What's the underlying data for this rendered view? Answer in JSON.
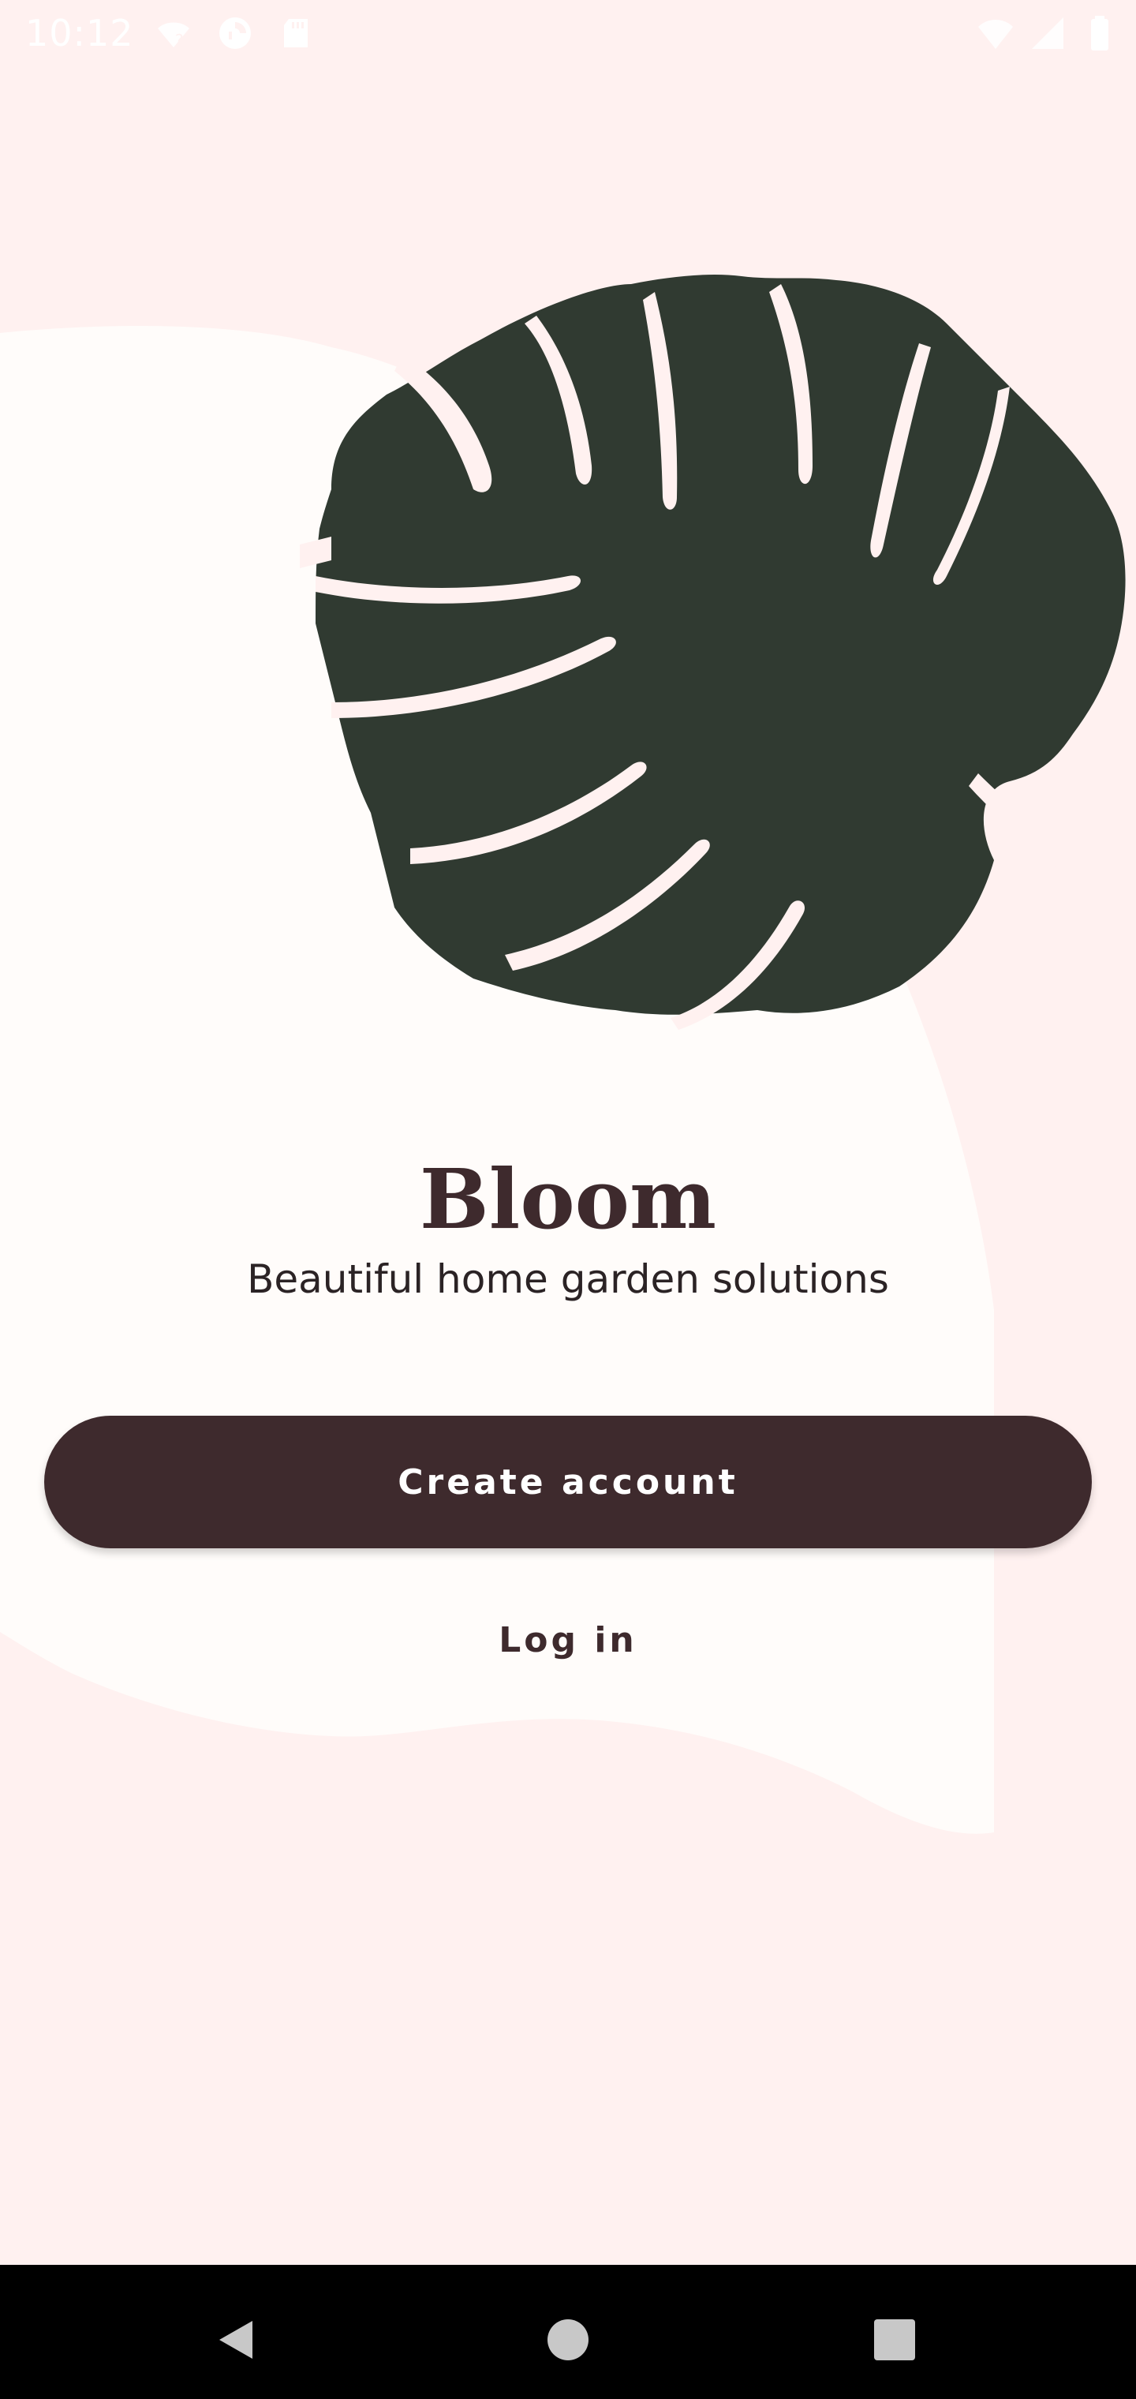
{
  "status_bar": {
    "time": "10:12",
    "icons": [
      "wifi-question-icon",
      "data-saver-icon",
      "sd-card-icon",
      "wifi-signal-icon",
      "cell-signal-icon",
      "battery-icon"
    ]
  },
  "welcome": {
    "app_name": "Bloom",
    "tagline": "Beautiful home garden solutions",
    "illustration": "monstera-leaf-icon"
  },
  "actions": {
    "create_account_label": "Create account",
    "login_label": "Log in"
  },
  "nav_bar": {
    "icons": [
      "back-icon",
      "home-icon",
      "recents-icon"
    ]
  },
  "colors": {
    "background": "#FFF1F0",
    "surface_shape": "#FFFCFA",
    "primary": "#3E2A2D",
    "leaf": "#303A31",
    "on_primary": "#FFFFFF",
    "nav_bar": "#000000"
  }
}
